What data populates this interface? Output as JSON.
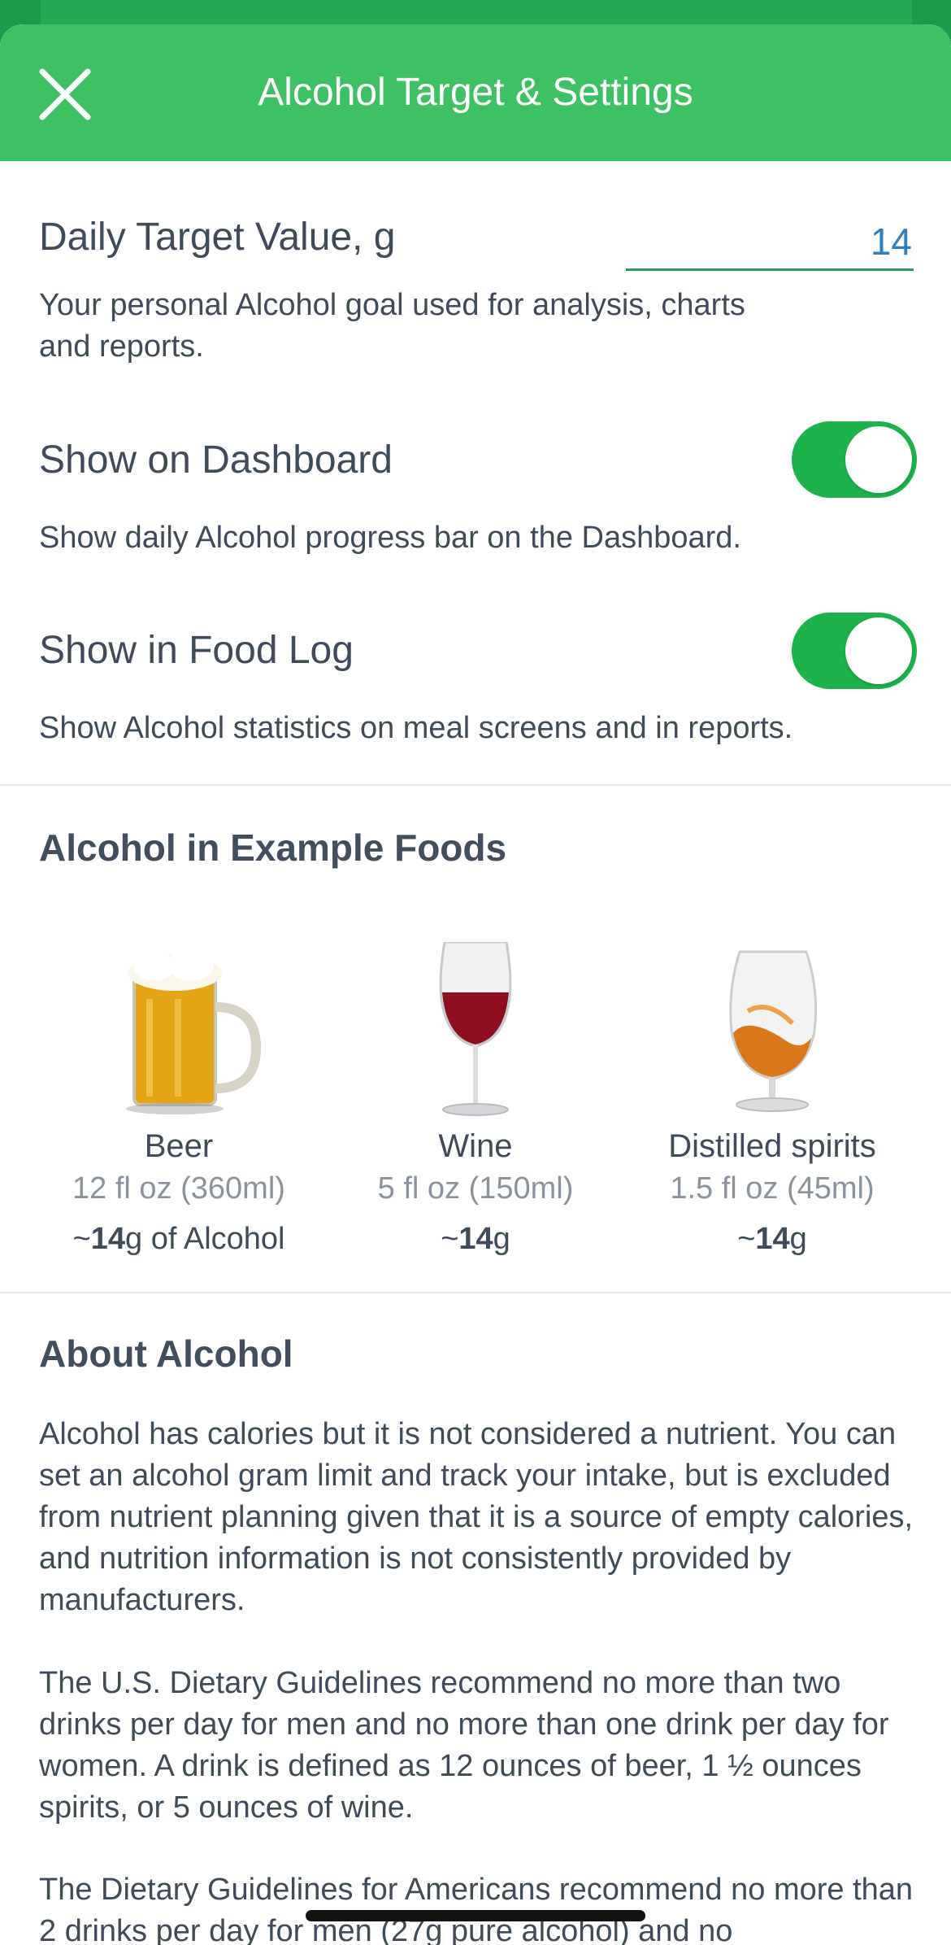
{
  "header": {
    "title": "Alcohol Target & Settings"
  },
  "target": {
    "label": "Daily Target Value, g",
    "value": "14",
    "description": "Your personal Alcohol goal used for analysis, charts and reports."
  },
  "dashboard": {
    "label": "Show on Dashboard",
    "enabled": true,
    "description": "Show daily Alcohol progress bar on the Dashboard."
  },
  "food_log": {
    "label": "Show in Food Log",
    "enabled": true,
    "description": "Show Alcohol statistics on meal screens and in reports."
  },
  "examples": {
    "title": "Alcohol in Example Foods",
    "items": [
      {
        "name": "Beer",
        "serving": "12 fl oz (360ml)",
        "amount_prefix": "~",
        "amount_bold": "14",
        "amount_suffix": "g of Alcohol"
      },
      {
        "name": "Wine",
        "serving": "5 fl oz (150ml)",
        "amount_prefix": "~",
        "amount_bold": "14",
        "amount_suffix": "g"
      },
      {
        "name": "Distilled spirits",
        "serving": "1.5 fl oz (45ml)",
        "amount_prefix": "~",
        "amount_bold": "14",
        "amount_suffix": "g"
      }
    ]
  },
  "about": {
    "title": "About Alcohol",
    "paragraphs": [
      "Alcohol has calories but it is not considered a nutrient. You can set an alcohol gram limit and track your intake, but is excluded from nutrient planning given that it is a source of empty calories, and nutrition information is not consistently provided by manufacturers.",
      "The U.S. Dietary Guidelines recommend no more than two drinks per day for men and no more than one drink per day for women. A drink is defined as 12 ounces of beer, 1 ½ ounces spirits, or 5 ounces of wine.",
      "The Dietary Guidelines for Americans recommend no more than 2 drinks per day for men (27g pure alcohol) and no"
    ]
  },
  "colors": {
    "header": "#3ec064",
    "toggle_on": "#1db24c",
    "input_value": "#2e7fc1"
  }
}
